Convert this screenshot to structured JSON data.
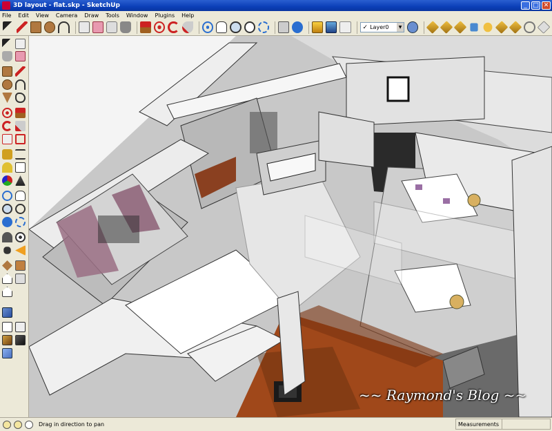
{
  "window": {
    "title": "3D layout - flat.skp - SketchUp",
    "minimize": "_",
    "maximize": "□",
    "close": "✕"
  },
  "menu": [
    "File",
    "Edit",
    "View",
    "Camera",
    "Draw",
    "Tools",
    "Window",
    "Plugins",
    "Help"
  ],
  "toolbar": {
    "layer_value": "Layer0",
    "layer_check": "✓",
    "layer_arrow": "▼"
  },
  "viewport": {
    "watermark": "~~ Raymond's Blog ~~"
  },
  "status": {
    "hint": "Drag in direction to pan",
    "measurements_label": "Measurements"
  },
  "colors": {
    "titlebar": "#0b3fb8",
    "chrome": "#ece9d8",
    "floor_wood": "#a0481a",
    "wall": "#f2f2f2"
  }
}
